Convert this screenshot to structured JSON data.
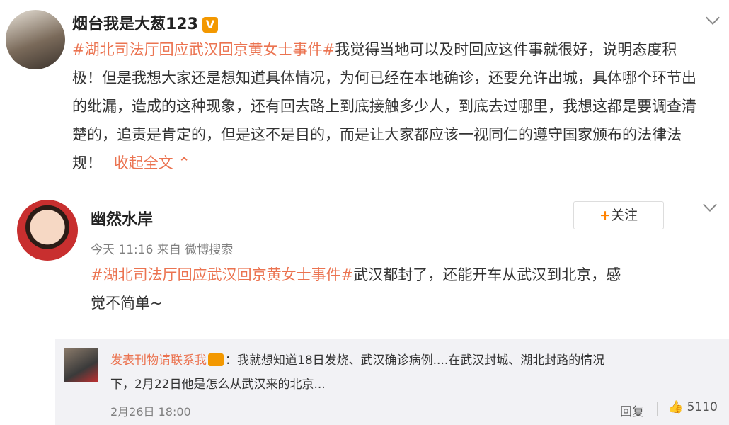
{
  "post1": {
    "author": "烟台我是大葱123",
    "badge": "V",
    "hashtag": "#湖北司法厅回应武汉回京黄女士事件#",
    "lines": [
      "我觉得当地可以及时回应这件事就很好，说明态度积",
      "极！但是我想大家还是想知道具体情况，为何已经在本地确诊，还要允许出城，具体哪个环节出",
      "的纰漏，造成的这种现象，还有回去路上到底接触多少人，到底去过哪里，我想这都是要调查清",
      "楚的，追责是肯定的，但是这不是目的，而是让大家都应该一视同仁的遵守国家颁布的法律法",
      "规！"
    ],
    "collapse": "收起全文"
  },
  "post2": {
    "author": "幽然水岸",
    "follow": "关注",
    "meta": "今天 11:16 来自 微博搜索",
    "hashtag": "#湖北司法厅回应武汉回京黄女士事件#",
    "lines": [
      "武汉都封了，还能开车从武汉到北京，感",
      "觉不简单~"
    ]
  },
  "reply": {
    "author": "发表刊物请联系我",
    "text1": "：我就想知道18日发烧、武汉确诊病例....在武汉封城、湖北封路的情况",
    "text2": "下，2月22日他是怎么从武汉来的北京...",
    "date": "2月26日 18:00",
    "reply_label": "回复",
    "likes": "5110"
  }
}
